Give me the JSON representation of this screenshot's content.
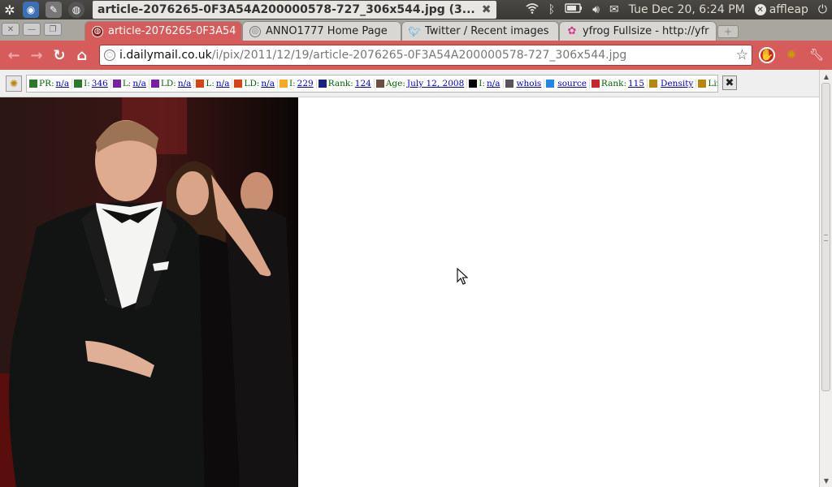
{
  "panel": {
    "window_title": "article-2076265-0F3A54A200000578-727_306x544.jpg (3...",
    "clock": "Tue Dec 20,  6:24 PM",
    "user": "affleap"
  },
  "tabs": [
    {
      "label": "article-2076265-0F3A54",
      "icon": "dailymail-favicon-icon"
    },
    {
      "label": "ANNO1777 Home Page",
      "icon": "globe-icon"
    },
    {
      "label": "Twitter / Recent images",
      "icon": "twitter-bird-icon"
    },
    {
      "label": "yfrog Fullsize - http://yfr",
      "icon": "yfrog-flower-icon"
    }
  ],
  "omnibox": {
    "host": "i.dailymail.co.uk",
    "path": "/i/pix/2011/12/19/article-2076265-0F3A54A200000578-727_306x544.jpg"
  },
  "seobar": {
    "items": [
      {
        "label": "PR:",
        "value": "n/a",
        "color": "#2a7a2a"
      },
      {
        "label": "I:",
        "value": "346",
        "color": "#2a7a2a"
      },
      {
        "label": "L:",
        "value": "n/a",
        "color": "#7b1fa2"
      },
      {
        "label": "LD:",
        "value": "n/a",
        "color": "#7b1fa2"
      },
      {
        "label": "L:",
        "value": "n/a",
        "color": "#d84315"
      },
      {
        "label": "LD:",
        "value": "n/a",
        "color": "#d84315"
      },
      {
        "label": "I:",
        "value": "229",
        "color": "#f9a825"
      },
      {
        "label": "Rank:",
        "value": "124",
        "color": "#1a237e"
      },
      {
        "label": "Age:",
        "value": "July 12, 2008",
        "color": "#6d4c41"
      },
      {
        "label": "I:",
        "value": "n/a",
        "color": "#000000"
      },
      {
        "label": "",
        "value": "whois",
        "color": "#555555"
      },
      {
        "label": "",
        "value": "source",
        "color": "#1e88e5"
      },
      {
        "label": "Rank:",
        "value": "115",
        "color": "#c62828"
      },
      {
        "label": "",
        "value": "Density",
        "color": "#b8860b"
      },
      {
        "label": "Links",
        "value": "",
        "color": "#b8860b"
      }
    ]
  },
  "colors": {
    "toolbar": "#d65b5b",
    "panel": "#3c3b37"
  }
}
